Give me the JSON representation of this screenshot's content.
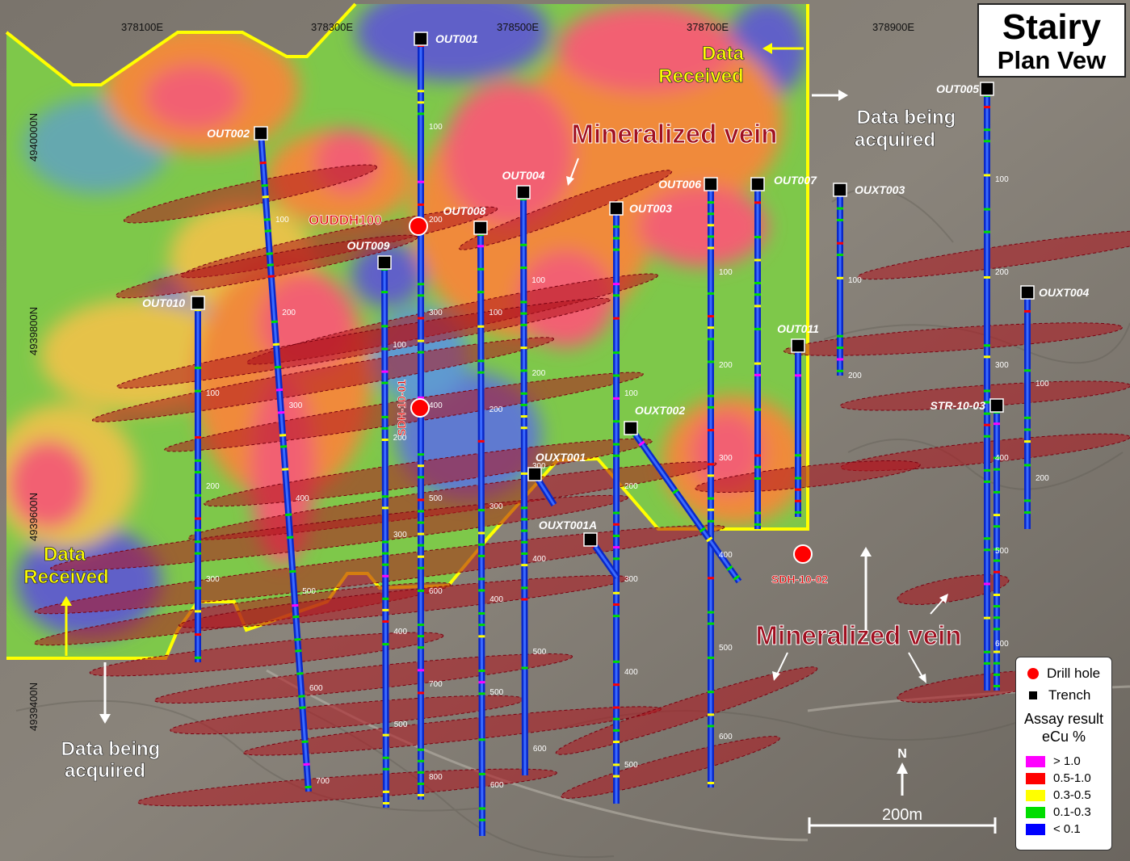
{
  "title": {
    "line1": "Stairy",
    "line2": "Plan Vew"
  },
  "easting_ticks": [
    "378100E",
    "378300E",
    "378500E",
    "378700E",
    "378900E"
  ],
  "northing_ticks": [
    "4940000N",
    "4939800N",
    "4939600N",
    "4939400N"
  ],
  "annotations": {
    "data_received_top": [
      "Data",
      "Received"
    ],
    "data_received_left": [
      "Data",
      "Received"
    ],
    "data_being_acquired_right": [
      "Data being",
      "acquired"
    ],
    "data_being_acquired_bottom": [
      "Data being",
      "acquired"
    ],
    "mineralized_vein_top": "Mineralized vein",
    "mineralized_vein_bottom": "Mineralized vein"
  },
  "drill_holes": [
    "OUDDH100",
    "SDH-10-01",
    "SDH-10-02"
  ],
  "trenches": [
    "OUT001",
    "OUT002",
    "OUT003",
    "OUT004",
    "OUT005",
    "OUT006",
    "OUT007",
    "OUT008",
    "OUT009",
    "OUT010",
    "OUT011",
    "OUXT001",
    "OUXT001A",
    "OUXT002",
    "OUXT003",
    "OUXT004",
    "STR-10-03"
  ],
  "depth_labels": [
    "100",
    "200",
    "300",
    "400",
    "500",
    "600",
    "700",
    "800"
  ],
  "north_arrow": "N",
  "scale_bar": "200m",
  "legend": {
    "drill_hole": "Drill hole",
    "trench": "Trench",
    "assay_title": [
      "Assay result",
      "eCu %"
    ],
    "classes": [
      {
        "label": "> 1.0",
        "color": "#ff00ff"
      },
      {
        "label": "0.5-1.0",
        "color": "#ff0000"
      },
      {
        "label": "0.3-0.5",
        "color": "#ffff00"
      },
      {
        "label": "0.1-0.3",
        "color": "#00dd00"
      },
      {
        "label": "< 0.1",
        "color": "#0000ff"
      }
    ]
  },
  "colors": {
    "boundary": "#ffff00",
    "vein": "#b0141e",
    "drill_hole": "#ff0000",
    "trench": "#000000"
  }
}
